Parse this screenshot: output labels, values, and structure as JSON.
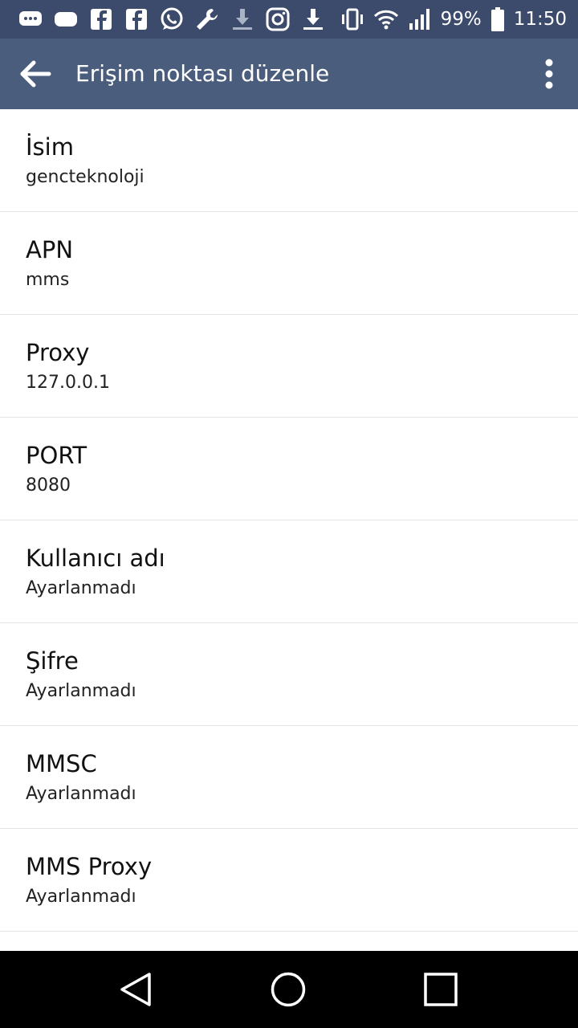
{
  "status_bar": {
    "notification_icons": [
      "messages-icon",
      "chat-bubble-icon",
      "facebook-icon",
      "facebook-icon",
      "whatsapp-icon",
      "wrench-icon",
      "download-icon",
      "instagram-icon",
      "download-icon"
    ],
    "battery": "99%",
    "time": "11:50"
  },
  "toolbar": {
    "title": "Erişim noktası düzenle"
  },
  "items": [
    {
      "title": "İsim",
      "value": "gencteknoloji"
    },
    {
      "title": "APN",
      "value": "mms"
    },
    {
      "title": "Proxy",
      "value": "127.0.0.1"
    },
    {
      "title": "PORT",
      "value": "8080"
    },
    {
      "title": "Kullanıcı adı",
      "value": "Ayarlanmadı"
    },
    {
      "title": "Şifre",
      "value": "Ayarlanmadı"
    },
    {
      "title": "MMSC",
      "value": "Ayarlanmadı"
    },
    {
      "title": "MMS Proxy",
      "value": "Ayarlanmadı"
    }
  ],
  "colors": {
    "status_bar": "#3c4a6b",
    "toolbar": "#4a5d7d",
    "nav_bar": "#000000"
  }
}
